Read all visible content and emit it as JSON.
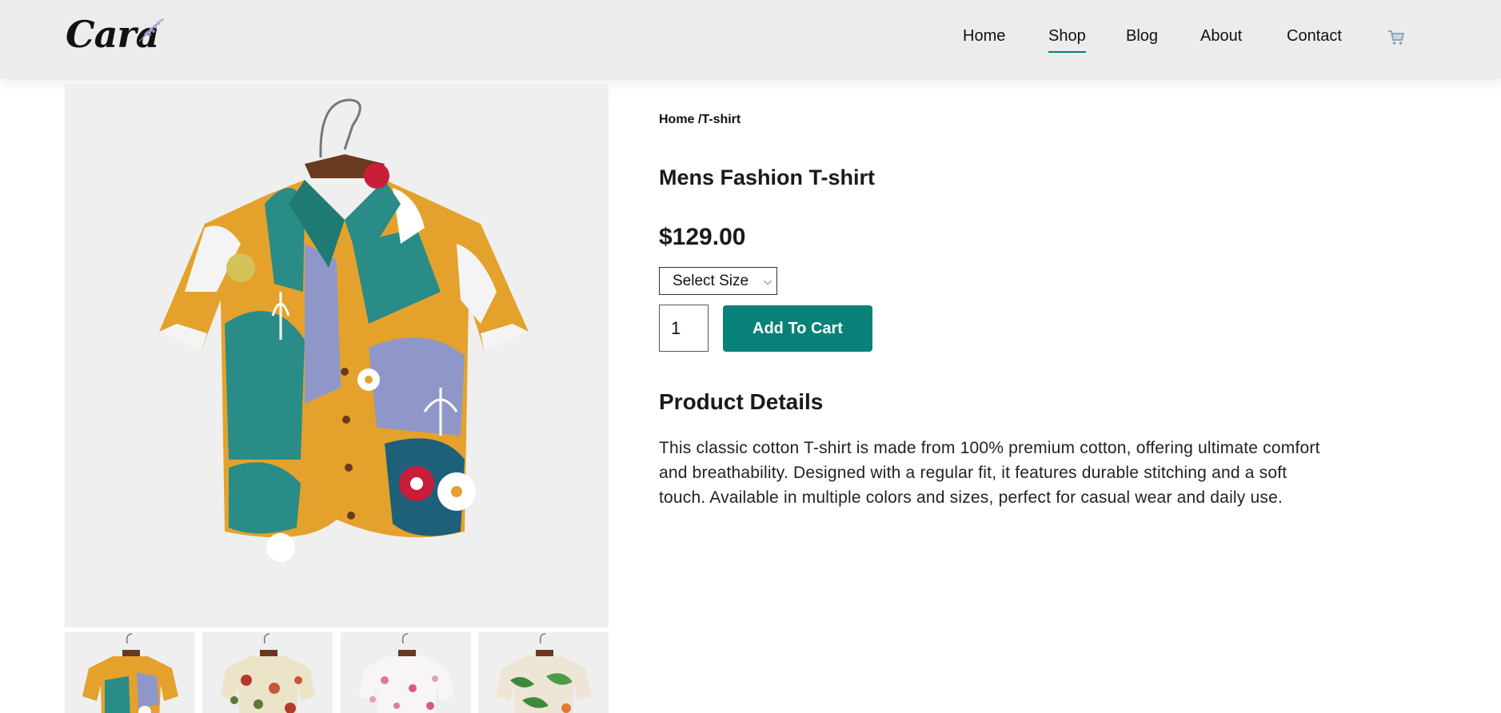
{
  "brand": {
    "logo_text": "Cara"
  },
  "nav": {
    "items": [
      {
        "label": "Home",
        "active": false
      },
      {
        "label": "Shop",
        "active": true
      },
      {
        "label": "Blog",
        "active": false
      },
      {
        "label": "About",
        "active": false
      },
      {
        "label": "Contact",
        "active": false
      }
    ],
    "cart_icon": "shopping-cart-icon"
  },
  "product": {
    "breadcrumb": "Home /T-shirt",
    "title": "Mens Fashion T-shirt",
    "price": "$129.00",
    "size_select": {
      "selected": "Select Size"
    },
    "quantity": "1",
    "add_to_cart_label": "Add To Cart",
    "details_heading": "Product Details",
    "description": "This classic cotton T-shirt is made from 100% premium cotton, offering ultimate comfort and breathability. Designed with a regular fit, it features durable stitching and a soft touch. Available in multiple colors and sizes, perfect for casual wear and daily use."
  },
  "colors": {
    "accent": "#088178",
    "header_bg": "#ececec",
    "image_bg": "#efefef"
  }
}
